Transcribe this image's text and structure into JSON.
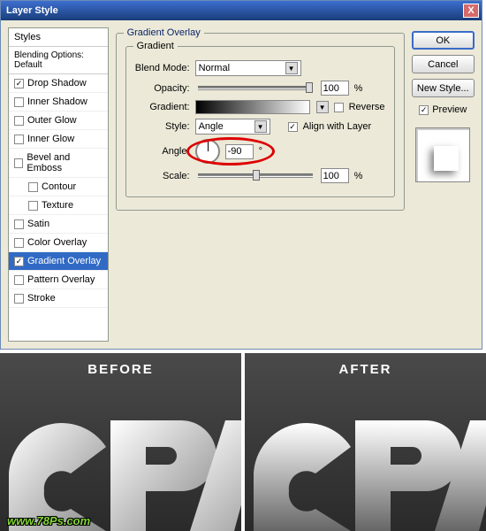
{
  "dialog": {
    "title": "Layer Style",
    "close": "X"
  },
  "styles": {
    "header": "Styles",
    "blending": "Blending Options: Default",
    "items": [
      {
        "label": "Drop Shadow",
        "checked": true,
        "selected": false
      },
      {
        "label": "Inner Shadow",
        "checked": false,
        "selected": false
      },
      {
        "label": "Outer Glow",
        "checked": false,
        "selected": false
      },
      {
        "label": "Inner Glow",
        "checked": false,
        "selected": false
      },
      {
        "label": "Bevel and Emboss",
        "checked": false,
        "selected": false
      },
      {
        "label": "Contour",
        "checked": false,
        "selected": false,
        "indent": true
      },
      {
        "label": "Texture",
        "checked": false,
        "selected": false,
        "indent": true
      },
      {
        "label": "Satin",
        "checked": false,
        "selected": false
      },
      {
        "label": "Color Overlay",
        "checked": false,
        "selected": false
      },
      {
        "label": "Gradient Overlay",
        "checked": true,
        "selected": true
      },
      {
        "label": "Pattern Overlay",
        "checked": false,
        "selected": false
      },
      {
        "label": "Stroke",
        "checked": false,
        "selected": false
      }
    ]
  },
  "gradient": {
    "title": "Gradient Overlay",
    "group": "Gradient",
    "blend_mode_label": "Blend Mode:",
    "blend_mode": "Normal",
    "opacity_label": "Opacity:",
    "opacity": "100",
    "percent": "%",
    "gradient_label": "Gradient:",
    "reverse_label": "Reverse",
    "reverse_checked": false,
    "style_label": "Style:",
    "style": "Angle",
    "align_label": "Align with Layer",
    "align_checked": true,
    "angle_label": "Angle:",
    "angle": "-90",
    "degree": "°",
    "scale_label": "Scale:",
    "scale": "100"
  },
  "buttons": {
    "ok": "OK",
    "cancel": "Cancel",
    "new_style": "New Style...",
    "preview": "Preview",
    "preview_checked": true
  },
  "compare": {
    "before": "BEFORE",
    "after": "AFTER",
    "watermark": "www.78Ps.com"
  }
}
